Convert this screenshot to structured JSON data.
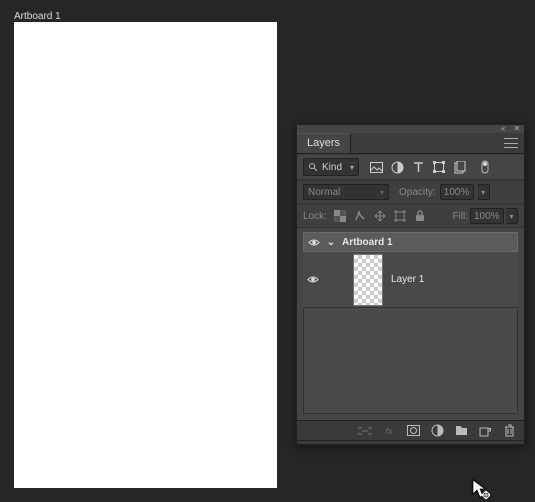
{
  "canvas": {
    "artboard_label": "Artboard 1"
  },
  "layers_panel": {
    "title": "Layers",
    "filter": {
      "mode": "Kind"
    },
    "blend": {
      "mode": "Normal",
      "opacity_label": "Opacity:",
      "opacity_value": "100%",
      "fill_label": "Fill:",
      "fill_value": "100%"
    },
    "lock": {
      "label": "Lock:"
    },
    "artboard": {
      "name": "Artboard 1"
    },
    "layers": [
      {
        "name": "Layer 1"
      }
    ]
  }
}
